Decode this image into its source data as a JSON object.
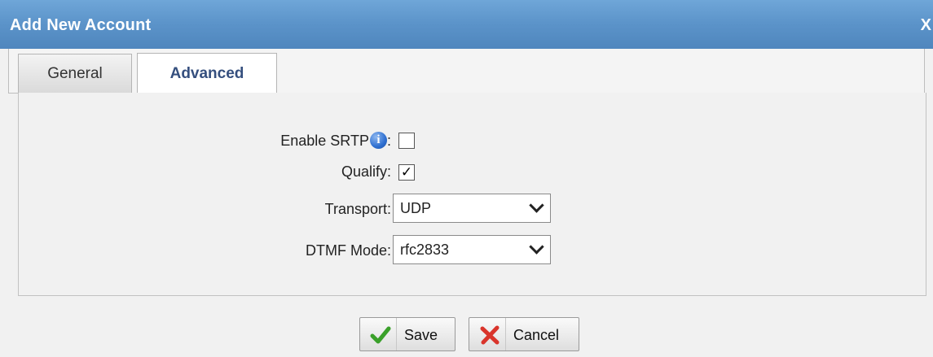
{
  "dialog": {
    "title": "Add New Account",
    "close_label": "X"
  },
  "tabs": [
    {
      "label": "General",
      "active": false
    },
    {
      "label": "Advanced",
      "active": true
    }
  ],
  "form": {
    "enable_srtp": {
      "label": "Enable SRTP",
      "suffix": ":",
      "info_icon": "i",
      "checked": false
    },
    "qualify": {
      "label": "Qualify:",
      "checked": true,
      "check_glyph": "✓"
    },
    "transport": {
      "label": "Transport:",
      "value": "UDP"
    },
    "dtmf_mode": {
      "label": "DTMF Mode:",
      "value": "rfc2833"
    }
  },
  "buttons": {
    "save": "Save",
    "cancel": "Cancel"
  },
  "colors": {
    "titlebar": "#5b93c9",
    "active_tab_text": "#354f7e",
    "save_icon": "#3aa02a",
    "cancel_icon": "#d9342b"
  }
}
